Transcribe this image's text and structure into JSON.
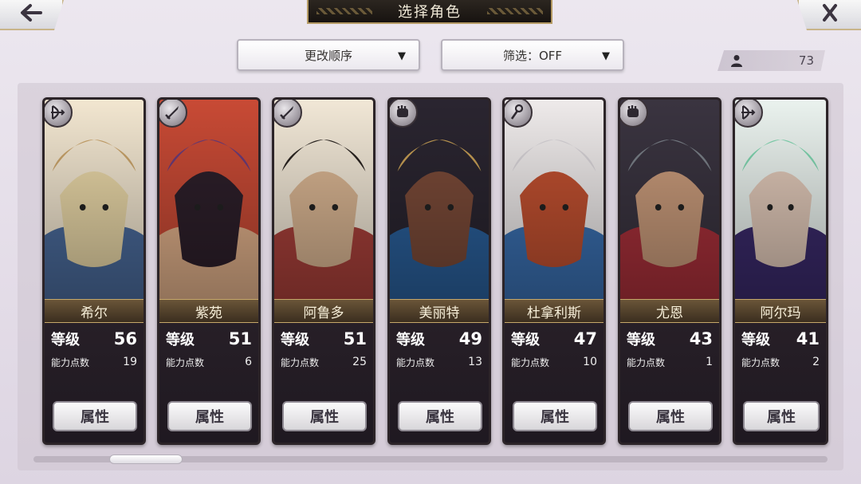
{
  "header": {
    "title": "选择角色",
    "back_icon": "arrow-left-icon",
    "close_icon": "close-icon"
  },
  "controls": {
    "sort_label": "更改顺序",
    "filter_label": "筛选：OFF",
    "caret_icon": "▼"
  },
  "roster": {
    "count": "73",
    "icon": "person-icon"
  },
  "labels": {
    "level": "等级",
    "ability_points": "能力点数",
    "attribute_button": "属性"
  },
  "characters": [
    {
      "name": "希尔",
      "level": "56",
      "points": "19",
      "type_icon": "bow-icon",
      "palette": [
        "#f2e6d0",
        "#caa46a",
        "#4a6a9a",
        "#e9d7a7"
      ]
    },
    {
      "name": "紫苑",
      "level": "51",
      "points": "6",
      "type_icon": "sword-icon",
      "palette": [
        "#c84a35",
        "#6b3b7a",
        "#e0b08a",
        "#2d1f2a"
      ]
    },
    {
      "name": "阿鲁多",
      "level": "51",
      "points": "25",
      "type_icon": "sword-icon",
      "palette": [
        "#f1e7d6",
        "#2a2420",
        "#a8403a",
        "#d9b592"
      ]
    },
    {
      "name": "美丽特",
      "level": "49",
      "points": "13",
      "type_icon": "fist-icon",
      "palette": [
        "#2a2530",
        "#c8a055",
        "#2a5f9a",
        "#7a4a38"
      ]
    },
    {
      "name": "杜拿利斯",
      "level": "47",
      "points": "10",
      "type_icon": "staff-icon",
      "palette": [
        "#eeeaea",
        "#d8d4d8",
        "#3a6fb0",
        "#c05030"
      ]
    },
    {
      "name": "尤恩",
      "level": "43",
      "points": "1",
      "type_icon": "fist-icon",
      "palette": [
        "#3a3440",
        "#7a8088",
        "#a8303a",
        "#c89a7a"
      ]
    },
    {
      "name": "阿尔玛",
      "level": "41",
      "points": "2",
      "type_icon": "bow-icon",
      "palette": [
        "#eaf2ee",
        "#7fd6b0",
        "#3a2a6a",
        "#e0c8b8"
      ]
    }
  ]
}
